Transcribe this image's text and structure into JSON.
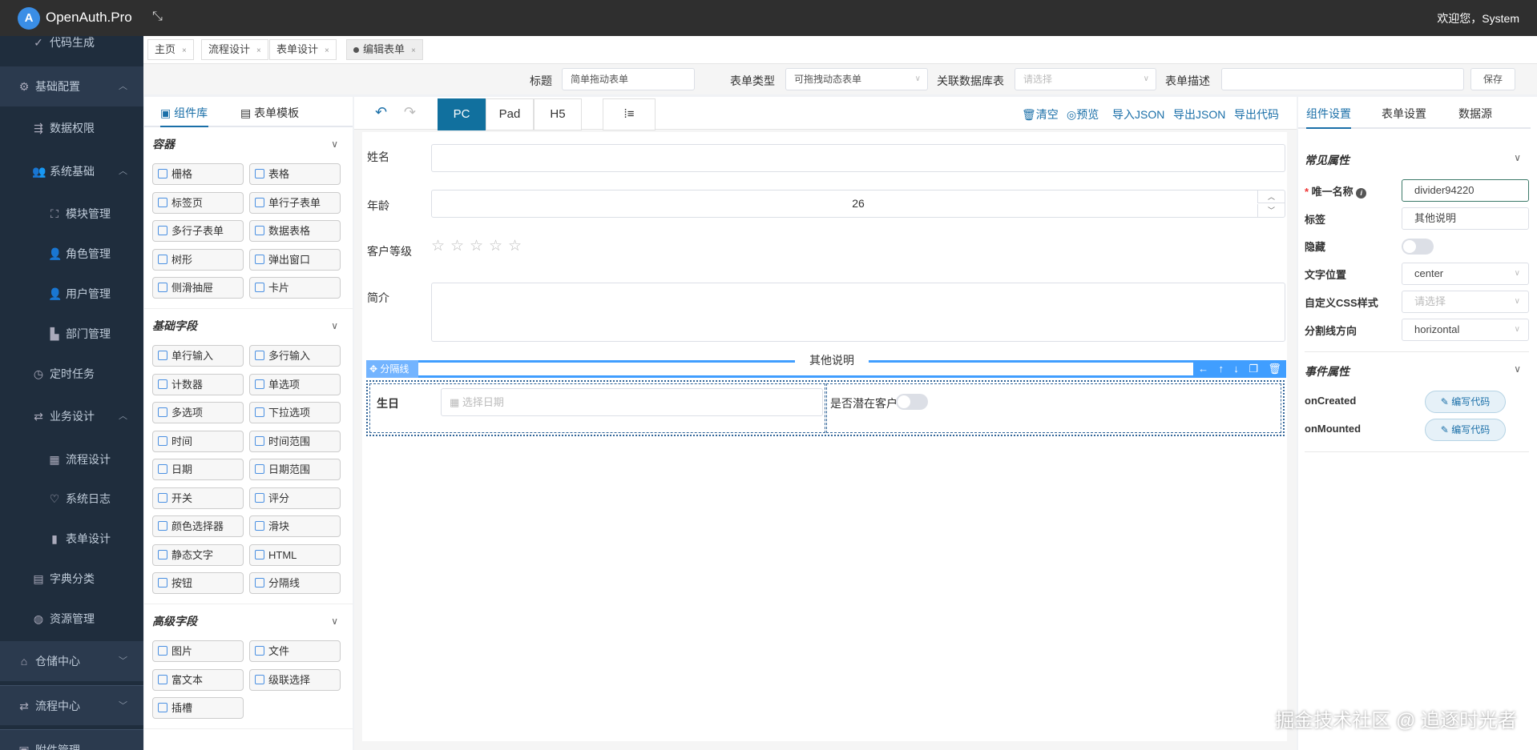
{
  "app": {
    "brand": "OpenAuth.Pro",
    "welcome": "欢迎您，System",
    "watermark": "掘金技术社区 @ 追逐时光者"
  },
  "sidebar": {
    "items": [
      {
        "label": "代码生成",
        "icon": "check-circle-icon",
        "level": 1
      },
      {
        "label": "基础配置",
        "icon": "gear-icon",
        "level": 0,
        "chev": "up"
      },
      {
        "label": "数据权限",
        "icon": "filter-icon",
        "level": 1
      },
      {
        "label": "系统基础",
        "icon": "users-icon",
        "level": 1,
        "chev": "up"
      },
      {
        "label": "模块管理",
        "icon": "sitemap-icon",
        "level": 2
      },
      {
        "label": "角色管理",
        "icon": "user-group-icon",
        "level": 2
      },
      {
        "label": "用户管理",
        "icon": "user-icon",
        "level": 2
      },
      {
        "label": "部门管理",
        "icon": "department-icon",
        "level": 2
      },
      {
        "label": "定时任务",
        "icon": "timer-icon",
        "level": 1
      },
      {
        "label": "业务设计",
        "icon": "flow-icon",
        "level": 1,
        "chev": "up"
      },
      {
        "label": "流程设计",
        "icon": "grid-icon",
        "level": 2
      },
      {
        "label": "系统日志",
        "icon": "log-icon",
        "level": 2
      },
      {
        "label": "表单设计",
        "icon": "form-icon",
        "level": 2
      },
      {
        "label": "字典分类",
        "icon": "book-icon",
        "level": 1
      },
      {
        "label": "资源管理",
        "icon": "globe-icon",
        "level": 1
      },
      {
        "label": "仓储中心",
        "icon": "warehouse-icon",
        "level": 0,
        "chev": "down"
      },
      {
        "label": "流程中心",
        "icon": "flow-icon",
        "level": 0,
        "chev": "down"
      },
      {
        "label": "附件管理",
        "icon": "attachment-icon",
        "level": 0
      }
    ]
  },
  "tabs": [
    {
      "label": "主页"
    },
    {
      "label": "流程设计"
    },
    {
      "label": "表单设计"
    },
    {
      "label": "编辑表单",
      "active": true
    }
  ],
  "formhead": {
    "title_label": "标题",
    "title_value": "简单拖动表单",
    "type_label": "表单类型",
    "type_value": "可拖拽动态表单",
    "db_label": "关联数据库表",
    "db_placeholder": "请选择",
    "desc_label": "表单描述",
    "desc_value": "",
    "save": "保存"
  },
  "library": {
    "tabs": [
      "组件库",
      "表单模板"
    ],
    "sections": [
      {
        "title": "容器",
        "items": [
          "栅格",
          "表格",
          "标签页",
          "单行子表单",
          "多行子表单",
          "数据表格",
          "树形",
          "弹出窗口",
          "侧滑抽屉",
          "卡片"
        ]
      },
      {
        "title": "基础字段",
        "items": [
          "单行输入",
          "多行输入",
          "计数器",
          "单选项",
          "多选项",
          "下拉选项",
          "时间",
          "时间范围",
          "日期",
          "日期范围",
          "开关",
          "评分",
          "颜色选择器",
          "滑块",
          "静态文字",
          "HTML",
          "按钮",
          "分隔线"
        ]
      },
      {
        "title": "高级字段",
        "items": [
          "图片",
          "文件",
          "富文本",
          "级联选择",
          "插槽"
        ]
      }
    ]
  },
  "toolbar": {
    "devices": [
      "PC",
      "Pad",
      "H5"
    ],
    "active_device": "PC",
    "actions": [
      "清空",
      "预览",
      "导入JSON",
      "导出JSON",
      "导出代码"
    ]
  },
  "form": {
    "name_label": "姓名",
    "name_value": "",
    "age_label": "年龄",
    "age_value": "26",
    "level_label": "客户等级",
    "rating": 0,
    "rating_max": 5,
    "intro_label": "简介",
    "intro_value": "",
    "divider_tag": "分隔线",
    "divider_text": "其他说明",
    "birthday_label": "生日",
    "birthday_placeholder": "选择日期",
    "potential_label": "是否潜在客户",
    "potential_on": false
  },
  "rpanel": {
    "tabs": [
      "组件设置",
      "表单设置",
      "数据源"
    ],
    "common_title": "常见属性",
    "fields": {
      "name_label": "唯一名称",
      "name_value": "divider94220",
      "tag_label": "标签",
      "tag_value": "其他说明",
      "hidden_label": "隐藏",
      "hidden_on": false,
      "pos_label": "文字位置",
      "pos_value": "center",
      "css_label": "自定义CSS样式",
      "css_placeholder": "请选择",
      "dir_label": "分割线方向",
      "dir_value": "horizontal"
    },
    "event_title": "事件属性",
    "events": [
      {
        "name": "onCreated",
        "button": "编写代码"
      },
      {
        "name": "onMounted",
        "button": "编写代码"
      }
    ]
  }
}
